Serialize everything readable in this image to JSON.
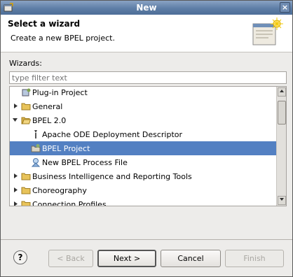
{
  "window": {
    "title": "New",
    "close_glyph": "×"
  },
  "header": {
    "title": "Select a wizard",
    "description": "Create a new BPEL project."
  },
  "wizards": {
    "label": "Wizards:",
    "filter_placeholder": "type filter text",
    "items": [
      {
        "label": "Plug-in Project",
        "icon": "plugin-icon",
        "level": 1,
        "expander": "none",
        "selected": false
      },
      {
        "label": "General",
        "icon": "folder-icon",
        "level": 0,
        "expander": "collapsed",
        "selected": false
      },
      {
        "label": "BPEL 2.0",
        "icon": "folder-open-icon",
        "level": 0,
        "expander": "expanded",
        "selected": false
      },
      {
        "label": "Apache ODE Deployment Descriptor",
        "icon": "descriptor-icon",
        "level": 1,
        "expander": "none",
        "selected": false
      },
      {
        "label": "BPEL Project",
        "icon": "bpel-project-icon",
        "level": 1,
        "expander": "none",
        "selected": true
      },
      {
        "label": "New BPEL Process File",
        "icon": "process-file-icon",
        "level": 1,
        "expander": "none",
        "selected": false
      },
      {
        "label": "Business Intelligence and Reporting Tools",
        "icon": "folder-icon",
        "level": 0,
        "expander": "collapsed",
        "selected": false
      },
      {
        "label": "Choreography",
        "icon": "folder-icon",
        "level": 0,
        "expander": "collapsed",
        "selected": false
      },
      {
        "label": "Connection Profiles",
        "icon": "folder-icon",
        "level": 0,
        "expander": "collapsed",
        "selected": false
      }
    ]
  },
  "buttons": {
    "help": "?",
    "back": "< Back",
    "next": "Next >",
    "cancel": "Cancel",
    "finish": "Finish"
  },
  "colors": {
    "selection": "#5380c2",
    "titlebar": "#6585ad",
    "folder": "#e8c35a"
  }
}
